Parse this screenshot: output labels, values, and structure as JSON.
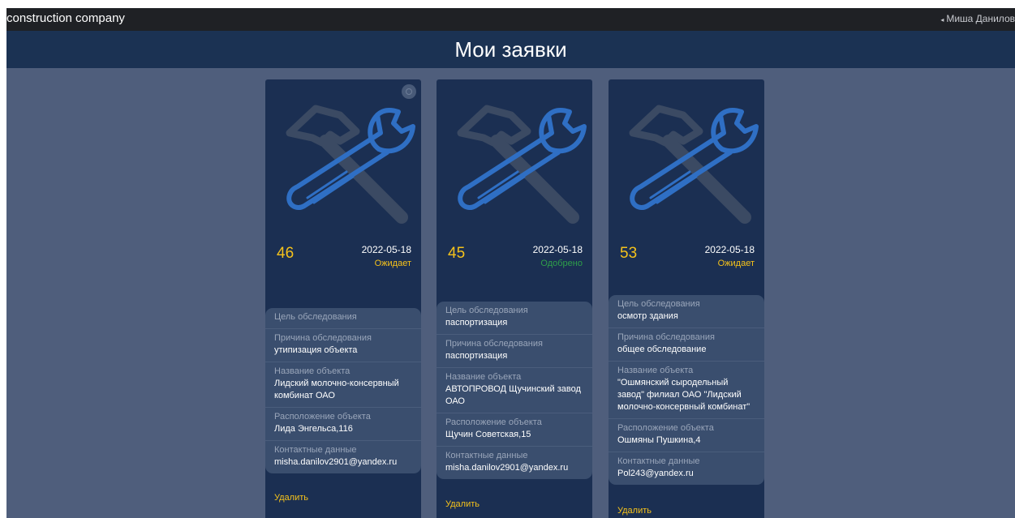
{
  "topbar": {
    "brand": "construction company",
    "user_caret": "◂",
    "user": "Миша Данилов"
  },
  "page": {
    "title": "Мои заявки"
  },
  "cards": [
    {
      "number": "46",
      "date": "2022-05-18",
      "status": "Ожидает",
      "fields": [
        {
          "label": "Цель обследования",
          "value": ""
        },
        {
          "label": "Причина обследования",
          "value": "утипизация объекта"
        },
        {
          "label": "Название объекта",
          "value": "Лидский молочно-консервный комбинат ОАО"
        },
        {
          "label": "Расположение объекта",
          "value": "Лида Энгельса,116"
        },
        {
          "label": "Контактные данные",
          "value": "misha.danilov2901@yandex.ru"
        }
      ],
      "delete_label": "Удалить"
    },
    {
      "number": "45",
      "date": "2022-05-18",
      "status": "Одобрено",
      "fields": [
        {
          "label": "Цель обследования",
          "value": "паспортизация"
        },
        {
          "label": "Причина обследования",
          "value": "паспортизация"
        },
        {
          "label": "Название объекта",
          "value": "АВТОПРОВОД Щучинский завод ОАО"
        },
        {
          "label": "Расположение объекта",
          "value": "Щучин Советская,15"
        },
        {
          "label": "Контактные данные",
          "value": "misha.danilov2901@yandex.ru"
        }
      ],
      "delete_label": "Удалить"
    },
    {
      "number": "53",
      "date": "2022-05-18",
      "status": "Ожидает",
      "fields": [
        {
          "label": "Цель обследования",
          "value": "осмотр здания"
        },
        {
          "label": "Причина обследования",
          "value": "общее обследование"
        },
        {
          "label": "Название объекта",
          "value": "\"Ошмянский сыродельный завод\" филиал ОАО \"Лидский молочно-консервный комбинат\""
        },
        {
          "label": "Расположение объекта",
          "value": "Ошмяны Пушкина,4"
        },
        {
          "label": "Контактные данные",
          "value": "Pol243@yandex.ru"
        }
      ],
      "delete_label": "Удалить"
    }
  ],
  "colors": {
    "background": "#4f5e7c",
    "card": "#1b2f52",
    "accent": "#f5c21b",
    "approved": "#2e9f4a",
    "wrench": "#2f6fc4",
    "hammer": "#3b4a63"
  },
  "icons": [
    "tools-icon",
    "gear-icon",
    "caret-left-icon"
  ]
}
